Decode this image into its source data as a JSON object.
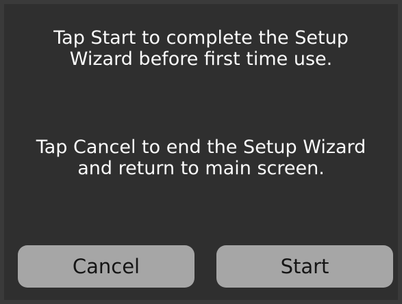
{
  "dialog": {
    "message_start": "Tap Start to complete the Setup Wizard before first time use.",
    "message_start_line1": "Tap Start to complete the Setup",
    "message_start_line2": "Wizard before first time use.",
    "message_cancel_line1": "Tap Cancel to end the Setup Wizard",
    "message_cancel_line2": "and return to main screen."
  },
  "buttons": {
    "cancel_label": "Cancel",
    "start_label": "Start"
  },
  "colors": {
    "background": "#2f2f2f",
    "button_fill": "#a6a6a6",
    "text": "#ffffff"
  }
}
